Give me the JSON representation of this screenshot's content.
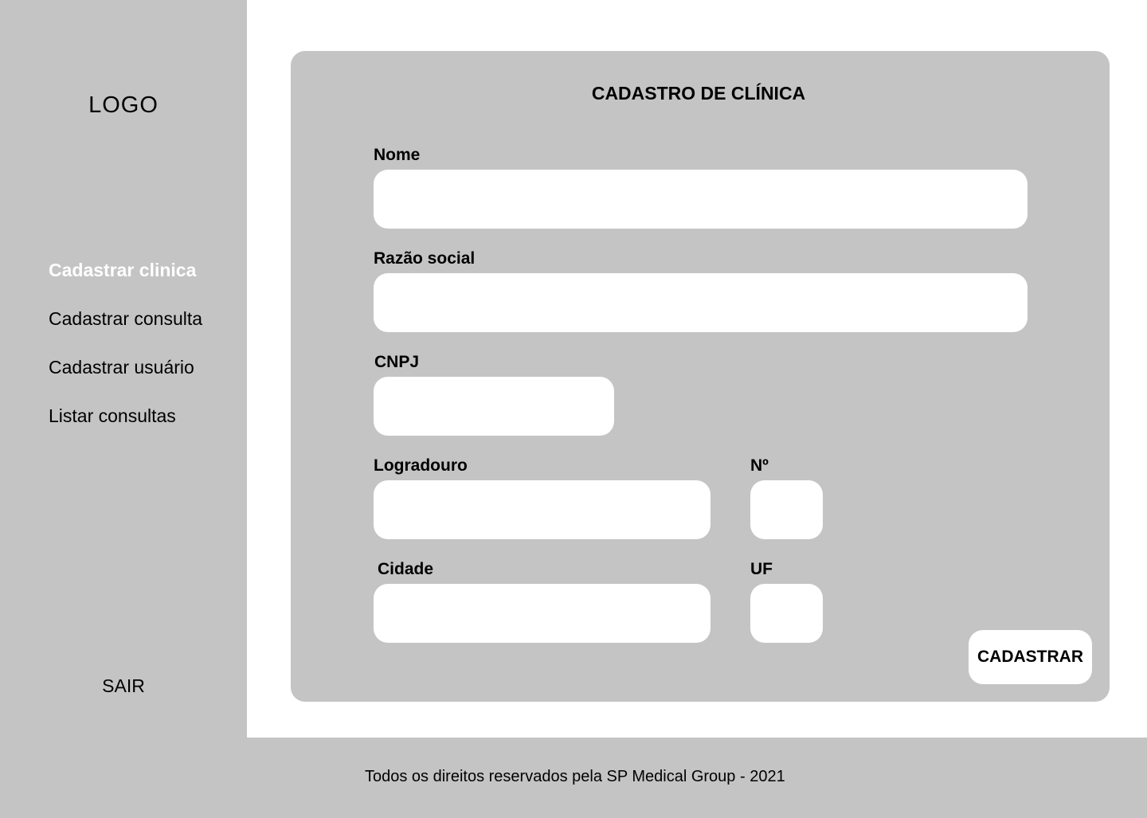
{
  "sidebar": {
    "logo": "LOGO",
    "items": [
      {
        "label": "Cadastrar clinica",
        "active": true
      },
      {
        "label": "Cadastrar consulta",
        "active": false
      },
      {
        "label": "Cadastrar usuário",
        "active": false
      },
      {
        "label": "Listar consultas",
        "active": false
      }
    ],
    "logout": "SAIR"
  },
  "form": {
    "title": "CADASTRO DE CLÍNICA",
    "fields": {
      "nome": {
        "label": "Nome",
        "value": ""
      },
      "razao_social": {
        "label": "Razão social",
        "value": ""
      },
      "cnpj": {
        "label": "CNPJ",
        "value": ""
      },
      "logradouro": {
        "label": "Logradouro",
        "value": ""
      },
      "numero": {
        "label": "Nº",
        "value": ""
      },
      "cidade": {
        "label": "Cidade",
        "value": ""
      },
      "uf": {
        "label": "UF",
        "value": ""
      }
    },
    "submit_label": "CADASTRAR"
  },
  "footer": {
    "text": "Todos os direitos reservados pela SP Medical Group - 2021"
  },
  "colors": {
    "panel": "#c4c4c4",
    "background": "#ffffff",
    "active_nav": "#ffffff"
  }
}
